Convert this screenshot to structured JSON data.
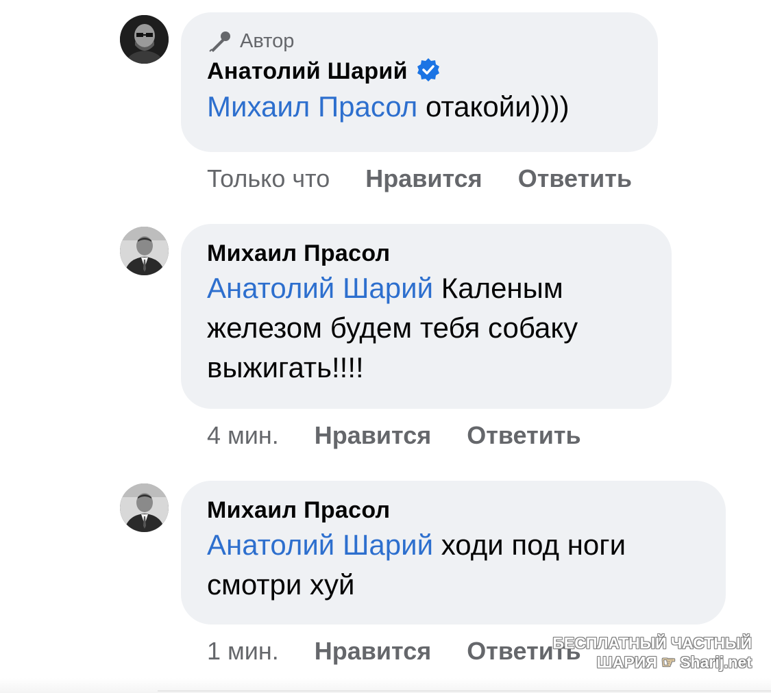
{
  "comments": [
    {
      "author_badge": "Автор",
      "author": "Анатолий Шарий",
      "verified_icon": "verified-check-icon",
      "mention": "Михаил Прасол",
      "text": " отакойи))))",
      "time": "Только что",
      "like_label": "Нравится",
      "reply_label": "Ответить"
    },
    {
      "author": "Михаил Прасол",
      "mention": "Анатолий Шарий",
      "text": " Каленым железом будем тебя собаку выжигать!!!!",
      "time": "4 мин.",
      "like_label": "Нравится",
      "reply_label": "Ответить"
    },
    {
      "author": "Михаил Прасол",
      "mention": "Анатолий Шарий",
      "text": " ходи под ноги смотри хуй",
      "time": "1 мин.",
      "like_label": "Нравится",
      "reply_label": "Ответить"
    }
  ],
  "watermark": {
    "line1": "БЕСПЛАТНЫЙ ЧАСТНЫЙ",
    "line2_left": "ШАРИЯ",
    "line2_right": "Sharij.net"
  },
  "colors": {
    "mention": "#2d6fce",
    "bubble": "#eff1f4",
    "meta": "#65676b",
    "verified": "#1b74e4"
  }
}
